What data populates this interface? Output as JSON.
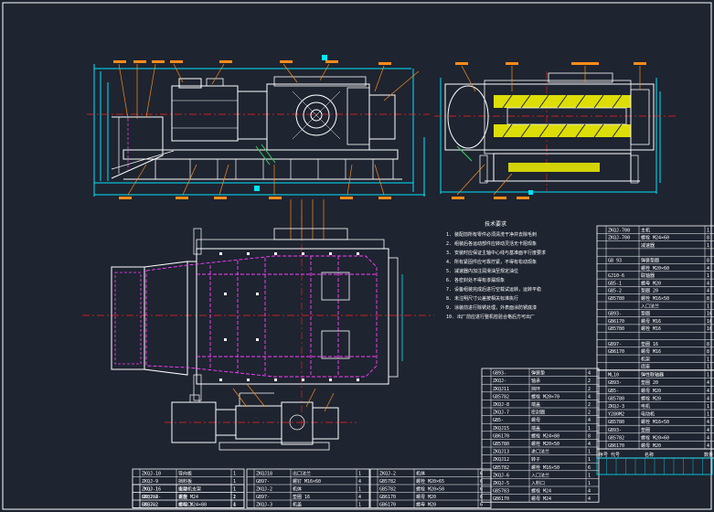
{
  "drawing": {
    "type": "CAD assembly drawing",
    "background_color": "#1e2430",
    "line_colors": {
      "outline": "#ffffff",
      "dimension": "#00e5ff",
      "centerline": "#ff2020",
      "hidden": "#ff40ff",
      "hatch": "#ffff00",
      "callout_tag": "#ff8c1a",
      "secondary": "#34d058"
    },
    "views": [
      "front-elevation",
      "side-section",
      "plan-view",
      "drive-motor-plan"
    ]
  },
  "notes": {
    "title": "技术要求",
    "lines": [
      "1. 装配前所有零件必须清洗干净并去除毛刺",
      "2. 组装后各运动部件应转动灵活无卡阻现象",
      "3. 安装时应保证主轴中心线与基准面平行度要求",
      "4. 所有紧固件应可靠拧紧，不得有松动现象",
      "5. 减速器内加注润滑油至规定油位",
      "6. 各密封处不得有渗漏现象",
      "7. 设备组装完成后进行空载试运转，运转平稳",
      "8. 未注明尺寸公差按相关标准执行",
      "9. 涂装前进行除锈处理，外表面涂防锈底漆",
      "10. 出厂前应进行整机检验合格后方可出厂"
    ]
  },
  "bom_right": {
    "rows": [
      {
        "code": "ZKQJ-700",
        "name": "主机",
        "qty": "1"
      },
      {
        "code": "ZKQJ-700",
        "name": "螺栓 M24×60",
        "qty": "8"
      },
      {
        "code": "",
        "name": "减速器",
        "qty": "1"
      },
      {
        "code": "",
        "name": "",
        "qty": ""
      },
      {
        "code": "GB 93",
        "name": "弹簧垫圈",
        "qty": "8"
      },
      {
        "code": "",
        "name": "螺栓 M20×60",
        "qty": "4"
      },
      {
        "code": "GJ10-6",
        "name": "联轴器",
        "qty": "1"
      },
      {
        "code": "GB5-1",
        "name": "螺母 M20",
        "qty": "4"
      },
      {
        "code": "GB5-2",
        "name": "垫圈 20",
        "qty": "4"
      },
      {
        "code": "GB5780",
        "name": "螺栓 M16×50",
        "qty": "8"
      },
      {
        "code": "",
        "name": "入口法兰",
        "qty": "1"
      },
      {
        "code": "GB93-",
        "name": "垫圈",
        "qty": "16"
      },
      {
        "code": "GB6170",
        "name": "螺母 M16",
        "qty": "16"
      },
      {
        "code": "GB5780",
        "name": "螺栓 M16",
        "qty": "16"
      },
      {
        "code": "",
        "name": "",
        "qty": ""
      },
      {
        "code": "GB97-",
        "name": "垫圈 16",
        "qty": "8"
      },
      {
        "code": "GB6170",
        "name": "螺母 M16",
        "qty": "8"
      },
      {
        "code": "",
        "name": "机架",
        "qty": "1"
      },
      {
        "code": "",
        "name": "底座",
        "qty": "1"
      }
    ]
  },
  "bom_middle": {
    "rows": [
      {
        "code": "GB93-",
        "name": "弹簧垫",
        "qty": "4"
      },
      {
        "code": "ZKQJ-",
        "name": "轴承",
        "qty": "2"
      },
      {
        "code": "ZKQJ11",
        "name": "挡环",
        "qty": "2"
      },
      {
        "code": "GB5782",
        "name": "螺栓 M20×70",
        "qty": "4"
      },
      {
        "code": "ZKQJ-8",
        "name": "端盖",
        "qty": "2"
      },
      {
        "code": "ZKQJ-7",
        "name": "密封圈",
        "qty": "2"
      },
      {
        "code": "GB5-",
        "name": "螺母",
        "qty": "4"
      },
      {
        "code": "ZKQJ15",
        "name": "端盖",
        "qty": "1"
      },
      {
        "code": "GB6170",
        "name": "螺栓 M24×80",
        "qty": "8"
      },
      {
        "code": "GB5780",
        "name": "螺栓 M20×50",
        "qty": "4"
      },
      {
        "code": "ZKQJ13",
        "name": "进口法兰",
        "qty": "1"
      },
      {
        "code": "ZKQJ12",
        "name": "转子",
        "qty": "1"
      },
      {
        "code": "GB5782",
        "name": "螺栓 M16×50",
        "qty": "6"
      },
      {
        "code": "ZKQJ-6",
        "name": "入口法兰",
        "qty": "1"
      },
      {
        "code": "ZKQJ-5",
        "name": "入料口",
        "qty": "1"
      },
      {
        "code": "GB5783",
        "name": "螺栓 M24",
        "qty": "4"
      },
      {
        "code": "GB6170",
        "name": "螺母 M24",
        "qty": "4"
      }
    ]
  },
  "bom_mid_right": {
    "rows": [
      {
        "code": "ML10",
        "name": "弹性联轴器",
        "qty": "1"
      },
      {
        "code": "GB93-",
        "name": "垫圈 20",
        "qty": "4"
      },
      {
        "code": "GB5-",
        "name": "螺母 M20",
        "qty": "4"
      },
      {
        "code": "GB5780",
        "name": "螺栓 M20",
        "qty": "4"
      },
      {
        "code": "ZKQJ-3",
        "name": "电机",
        "qty": "1"
      },
      {
        "code": "Y280M2",
        "name": "电动机",
        "qty": "1"
      },
      {
        "code": "GB5780",
        "name": "螺栓 M16×50",
        "qty": "4"
      },
      {
        "code": "GB93-",
        "name": "垫圈",
        "qty": "4"
      },
      {
        "code": "GB5782",
        "name": "螺栓 M20×60",
        "qty": "4"
      },
      {
        "code": "GB6170",
        "name": "螺母 M20",
        "qty": "4"
      }
    ],
    "header": [
      "序号",
      "代号",
      "名称",
      "数量"
    ]
  },
  "bom_bottom_left": {
    "rows": [
      {
        "code": "ZKQJ-10",
        "name": "导向板",
        "qty": "1"
      },
      {
        "code": "ZKQJ-9",
        "name": "挡料板",
        "qty": "1"
      },
      {
        "code": "ZKQJ-1",
        "name": "支架",
        "qty": "1"
      },
      {
        "code": "GB5782-",
        "name": "螺栓 M24",
        "qty": "2"
      },
      {
        "code": "ZKQJ-2",
        "name": "出料口",
        "qty": "1"
      }
    ]
  },
  "bom_bottom_mid": {
    "rows": [
      {
        "code": "ZKQJ18",
        "name": "出口法兰",
        "qty": "1"
      },
      {
        "code": "GB97-",
        "name": "螺钉 M16×60",
        "qty": "4"
      },
      {
        "code": "ZKQJ-2",
        "name": "机体",
        "qty": "1"
      },
      {
        "code": "GB97-",
        "name": "垫圈 16",
        "qty": "4"
      },
      {
        "code": "ZKQJ-3",
        "name": "机盖",
        "qty": "1"
      }
    ]
  },
  "bom_bottom_third": {
    "rows": [
      {
        "code": "ZKQJ-2",
        "name": "机体",
        "qty": "6"
      },
      {
        "code": "GB5782",
        "name": "螺栓 M20×65",
        "qty": "6"
      },
      {
        "code": "GB5782",
        "name": "螺栓 M20×50",
        "qty": "6"
      },
      {
        "code": "GB6170",
        "name": "螺母 M20",
        "qty": "6"
      },
      {
        "code": "GB6170",
        "name": "螺母 M20",
        "qty": "6"
      }
    ]
  },
  "bom_bottom_left_strip": {
    "rows": [
      {
        "code": "ZKQJ-16",
        "name": "电动机支架",
        "qty": "1"
      },
      {
        "code": "ZKQJ-4",
        "name": "支座",
        "qty": "1"
      },
      {
        "code": "GB5782",
        "name": "螺栓 M24×80",
        "qty": "4"
      }
    ]
  }
}
